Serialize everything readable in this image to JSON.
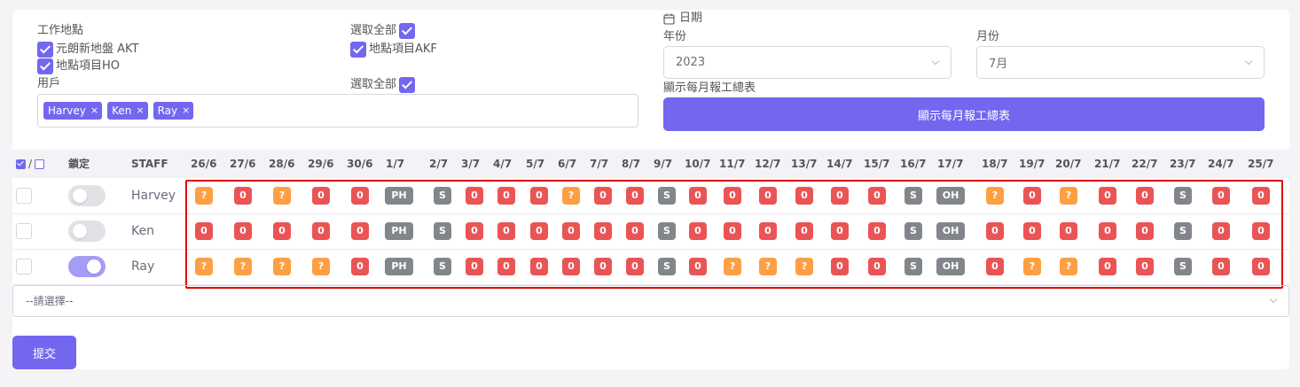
{
  "filters": {
    "location_label": "工作地點",
    "locations": [
      {
        "label": "元朗新地盤 AKT",
        "checked": true
      },
      {
        "label": "地點項目HO",
        "checked": true
      },
      {
        "label": "地點項目AKF",
        "checked": true
      }
    ],
    "select_all_label": "選取全部",
    "user_label": "用戶",
    "user_select_all_label": "選取全部",
    "users": [
      "Harvey",
      "Ken",
      "Ray"
    ],
    "tag_remove": "×"
  },
  "date": {
    "label": "日期",
    "year_label": "年份",
    "year_value": "2023",
    "month_label": "月份",
    "month_value": "7月",
    "summary_label": "顯示每月報工總表",
    "summary_button": "顯示每月報工總表"
  },
  "table": {
    "header_slash": "/",
    "lock_header": "鎖定",
    "staff_header": "STAFF",
    "dates": [
      "26/6",
      "27/6",
      "28/6",
      "29/6",
      "30/6",
      "1/7",
      "2/7",
      "3/7",
      "4/7",
      "5/7",
      "6/7",
      "7/7",
      "8/7",
      "9/7",
      "10/7",
      "11/7",
      "12/7",
      "13/7",
      "14/7",
      "15/7",
      "16/7",
      "17/7",
      "18/7",
      "19/7",
      "20/7",
      "21/7",
      "22/7",
      "23/7",
      "24/7",
      "25/7"
    ],
    "rows": [
      {
        "name": "Harvey",
        "locked": false,
        "cells": [
          "?",
          "0",
          "?",
          "0",
          "0",
          "PH",
          "S",
          "0",
          "0",
          "0",
          "?",
          "0",
          "0",
          "S",
          "0",
          "0",
          "0",
          "0",
          "0",
          "0",
          "S",
          "OH",
          "?",
          "0",
          "?",
          "0",
          "0",
          "S",
          "0",
          "0"
        ]
      },
      {
        "name": "Ken",
        "locked": false,
        "cells": [
          "0",
          "0",
          "0",
          "0",
          "0",
          "PH",
          "S",
          "0",
          "0",
          "0",
          "0",
          "0",
          "0",
          "S",
          "0",
          "0",
          "0",
          "0",
          "0",
          "0",
          "S",
          "OH",
          "0",
          "0",
          "0",
          "0",
          "0",
          "S",
          "0",
          "0"
        ]
      },
      {
        "name": "Ray",
        "locked": true,
        "cells": [
          "?",
          "?",
          "?",
          "?",
          "0",
          "PH",
          "S",
          "0",
          "0",
          "0",
          "0",
          "0",
          "0",
          "S",
          "0",
          "?",
          "?",
          "?",
          "0",
          "0",
          "S",
          "OH",
          "0",
          "?",
          "?",
          "0",
          "0",
          "S",
          "0",
          "0"
        ]
      }
    ]
  },
  "bottom_select_placeholder": "--請選擇--",
  "submit_label": "提交",
  "colors": {
    "accent": "#7367f0",
    "red": "#ea5455",
    "orange": "#ff9f43",
    "gray": "#82868b",
    "highlight_border": "#e00000"
  },
  "icons": {
    "calendar": "calendar-icon",
    "chevron": "chevron-down-icon",
    "checkbox": "checkbox-checked-icon"
  }
}
